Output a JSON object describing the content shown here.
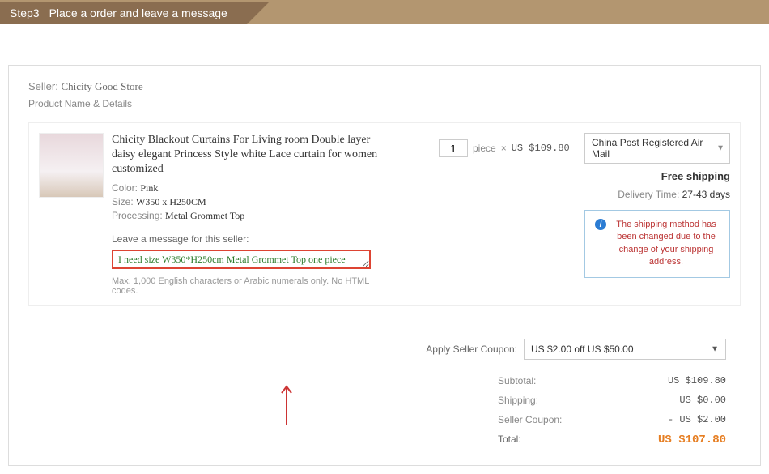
{
  "step": {
    "num": "Step3",
    "title": "Place a order and leave a message"
  },
  "seller": {
    "label": "Seller:",
    "name": "Chicity Good Store"
  },
  "productDetailsLabel": "Product Name & Details",
  "product": {
    "title": "Chicity Blackout Curtains For Living room Double layer daisy elegant Princess Style white Lace curtain for women customized",
    "colorLabel": "Color:",
    "colorValue": "Pink",
    "sizeLabel": "Size:",
    "sizeValue": "W350 x H250CM",
    "processingLabel": "Processing:",
    "processingValue": "Metal Grommet Top"
  },
  "message": {
    "label": "Leave a message for this seller:",
    "value": "I need size W350*H250cm Metal Grommet Top one piece",
    "hint": "Max. 1,000 English characters or Arabic numerals only. No HTML codes."
  },
  "qty": {
    "value": "1",
    "unit": "piece",
    "times": "×",
    "price": "US $109.80"
  },
  "shipping": {
    "method": "China Post Registered Air Mail",
    "free": "Free shipping",
    "deliveryLabel": "Delivery Time:",
    "deliveryDays": "27-43 days",
    "notice": "The shipping method has been changed due to the change of your shipping address."
  },
  "coupon": {
    "label": "Apply Seller Coupon:",
    "selected": "US $2.00 off US $50.00"
  },
  "summary": {
    "subtotalLabel": "Subtotal:",
    "subtotalVal": "US $109.80",
    "shippingLabel": "Shipping:",
    "shippingVal": "US $0.00",
    "couponLabel": "Seller Coupon:",
    "couponVal": "- US $2.00",
    "totalLabel": "Total:",
    "totalVal": "US $107.80"
  }
}
